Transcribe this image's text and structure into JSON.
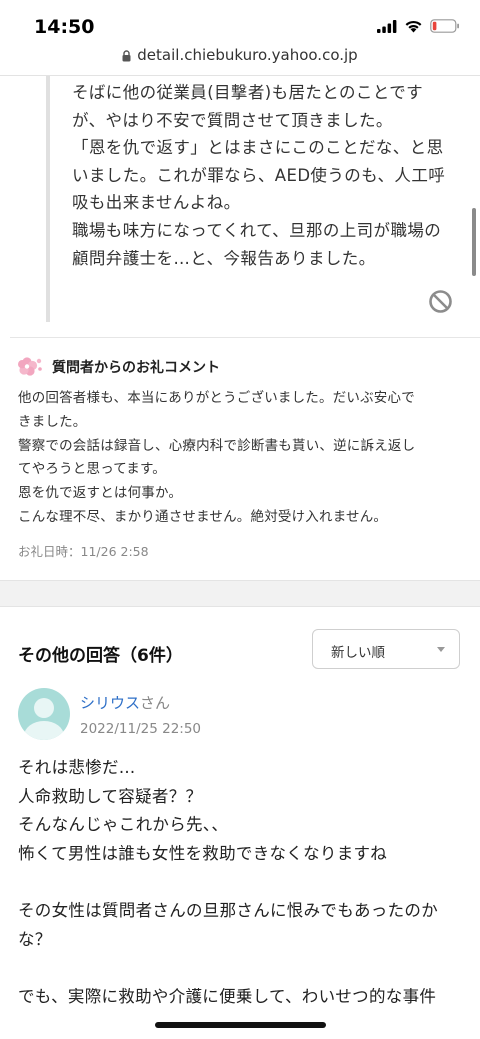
{
  "status_bar": {
    "time": "14:50"
  },
  "browser": {
    "url": "detail.chiebukuro.yahoo.co.jp"
  },
  "quoted_answer": {
    "lines": [
      "そばに他の従業員(目撃者)も居たとのことです",
      "が、やはり不安で質問させて頂きました。",
      "「恩を仇で返す」とはまさにこのことだな、と思",
      "いました。これが罪なら、AED使うのも、人工呼",
      "吸も出来ませんよね。",
      "職場も味方になってくれて、旦那の上司が職場の",
      "顧問弁護士を…と、今報告ありました。"
    ],
    "report_icon": "ban-icon"
  },
  "thanks": {
    "title": "質問者からのお礼コメント",
    "lines": [
      "他の回答者様も、本当にありがとうございました。だいぶ安心で",
      "きました。",
      "警察での会話は録音し、心療内科で診断書も貰い、逆に訴え返し",
      "てやろうと思ってます。",
      "恩を仇で返すとは何事か。",
      "こんな理不尽、まかり通させません。絶対受け入れません。"
    ],
    "date": "お礼日時：11/26 2:58",
    "icon": "flower-icon"
  },
  "other_answers": {
    "title": "その他の回答（6件）",
    "sort_selected": "新しい順"
  },
  "answer": {
    "user_name": "シリウス",
    "user_suffix": "さん",
    "date": "2022/11/25 22:50",
    "paragraphs": [
      [
        "それは悲惨だ…",
        "人命救助して容疑者？？",
        "そんなんじゃこれから先、、",
        "怖くて男性は誰も女性を救助できなくなりますね"
      ],
      [
        "その女性は質問者さんの旦那さんに恨みでもあったのか",
        "な？"
      ],
      [
        "でも、実際に救助や介護に便乗して、わいせつ的な事件"
      ]
    ]
  },
  "colors": {
    "link": "#2e6fc7",
    "avatar": "#a8dcd8",
    "battery_low": "#e8453c",
    "muted": "#888888"
  }
}
